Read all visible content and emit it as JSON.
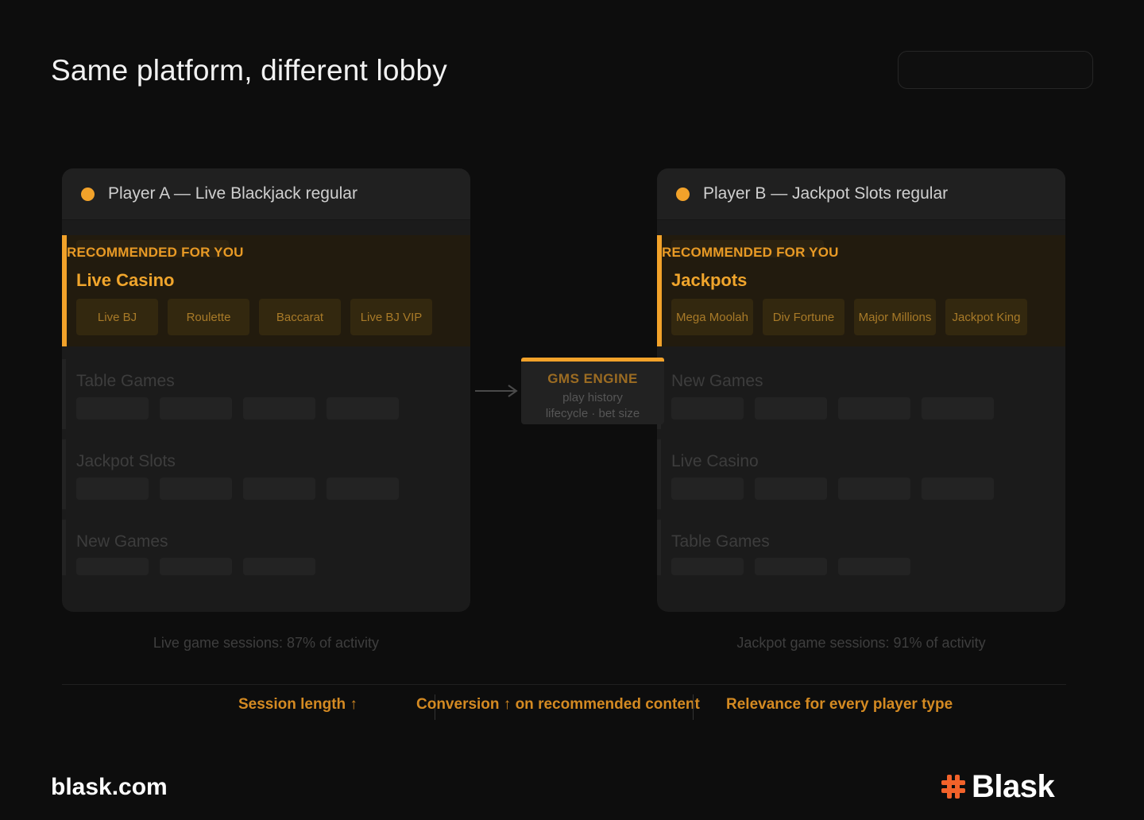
{
  "page": {
    "title": "Same platform, different lobby",
    "footer_url": "blask.com",
    "logo": {
      "mark": "#",
      "text": "Blask"
    }
  },
  "colors": {
    "background": "#0d0d0d",
    "accent": "#f2a22a",
    "card": "#1b1b1b",
    "reco_background": "#221b0e",
    "muted_text": "#3e3e3e"
  },
  "players": [
    {
      "label": "Player A — Live Blackjack regular",
      "recommended": {
        "label": "RECOMMENDED FOR YOU",
        "title": "Live Casino",
        "games": [
          "Live BJ",
          "Roulette",
          "Baccarat",
          "Live BJ VIP"
        ]
      },
      "sections": [
        {
          "name": "Table Games"
        },
        {
          "name": "Jackpot Slots"
        },
        {
          "name": "New Games"
        }
      ],
      "caption": "Live game sessions: 87% of activity"
    },
    {
      "label": "Player B — Jackpot Slots regular",
      "recommended": {
        "label": "RECOMMENDED FOR YOU",
        "title": "Jackpots",
        "games": [
          "Mega Moolah",
          "Div Fortune",
          "Major Millions",
          "Jackpot King"
        ]
      },
      "sections": [
        {
          "name": "New Games"
        },
        {
          "name": "Live Casino"
        },
        {
          "name": "Table Games"
        }
      ],
      "caption": "Jackpot game sessions: 91% of activity"
    }
  ],
  "engine": {
    "title": "GMS ENGINE",
    "line1": "play history",
    "line2": "lifecycle · bet size"
  },
  "benefits": [
    "Session length ↑",
    "Conversion ↑ on recommended content",
    "Relevance for every player type"
  ]
}
